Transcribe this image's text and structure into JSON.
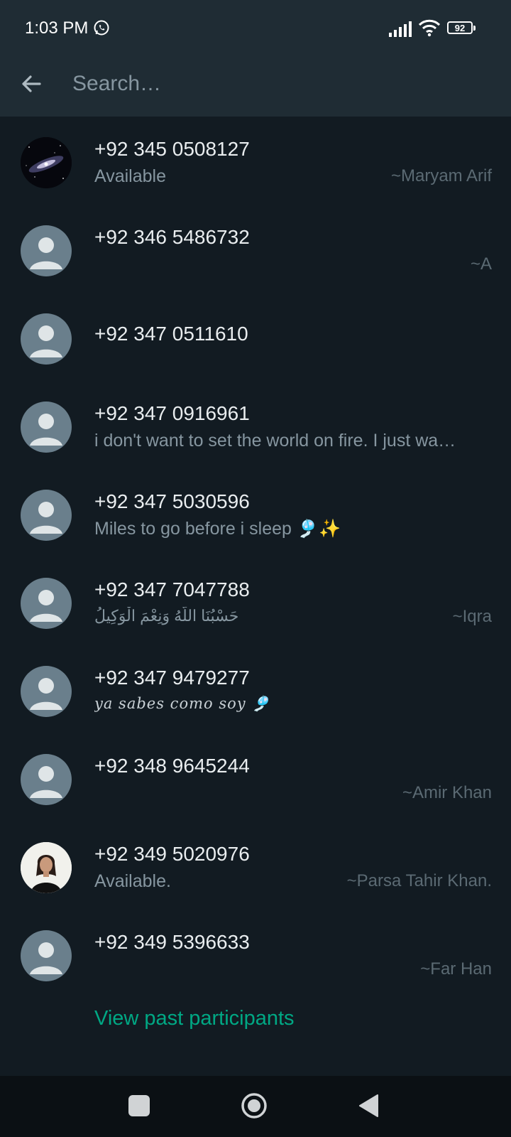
{
  "status_bar": {
    "time": "1:03 PM",
    "battery": "92",
    "icons": [
      "whatsapp-icon",
      "signal-icon",
      "wifi-icon",
      "battery-icon"
    ]
  },
  "header": {
    "back_icon": "arrow-left-icon",
    "search_placeholder": "Search…"
  },
  "participants": [
    {
      "number": "+92 345 0508127",
      "status": "Available",
      "pushname": "~Maryam Arif",
      "avatar": "galaxy-photo"
    },
    {
      "number": "+92 346 5486732",
      "status": "",
      "pushname": "~A",
      "avatar": "default"
    },
    {
      "number": "+92 347 0511610",
      "status": "",
      "pushname": "",
      "avatar": "default"
    },
    {
      "number": "+92 347 0916961",
      "status": "i don't want to set the world on fire. I just wa…",
      "pushname": "",
      "avatar": "default"
    },
    {
      "number": "+92 347 5030596",
      "status": "Miles to go before i sleep 🎐✨",
      "pushname": "",
      "avatar": "default"
    },
    {
      "number": "+92 347 7047788",
      "status": "حَسْبُنَا اللَّهُ وَنِعْمَ الْوَكِيلُ",
      "pushname": "~Iqra",
      "avatar": "default"
    },
    {
      "number": "+92 347 9479277",
      "status": "ya sabes como soy 🎐",
      "pushname": "",
      "avatar": "default"
    },
    {
      "number": "+92 348 9645244",
      "status": "",
      "pushname": "~Amir Khan",
      "avatar": "default"
    },
    {
      "number": "+92 349 5020976",
      "status": "Available.",
      "pushname": "~Parsa Tahir Khan.",
      "avatar": "person-photo"
    },
    {
      "number": "+92 349 5396633",
      "status": "",
      "pushname": "~Far Han",
      "avatar": "default"
    }
  ],
  "footer": {
    "view_past": "View past participants"
  },
  "colors": {
    "background": "#121b22",
    "header": "#1f2c34",
    "accent": "#00a884",
    "secondary_text": "#8696a0"
  }
}
